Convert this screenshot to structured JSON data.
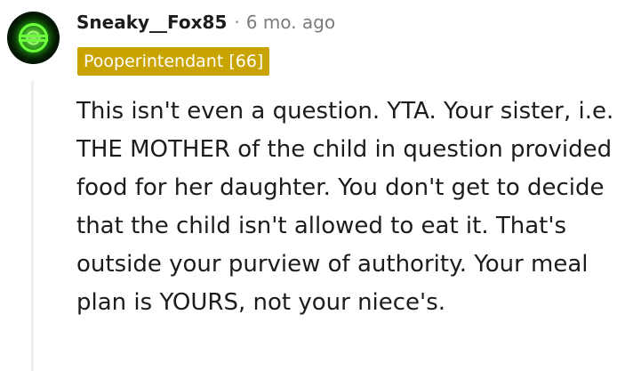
{
  "comment": {
    "username": "Sneaky__Fox85",
    "separator": "·",
    "timestamp": "6 mo. ago",
    "flair": "Pooperintendant [66]",
    "body": "This isn't even a question. YTA. Your sister, i.e. THE MOTHER of the child in question provided food for her daughter. You don't get to decide that the child isn't allowed to eat it. That's outside your purview of authority. Your meal plan is YOURS, not your niece's.",
    "avatar_icon": "green-lantern-emblem-icon"
  },
  "colors": {
    "flair_background": "#c9a400",
    "flair_text": "#ffffff",
    "username": "#1c1c1c",
    "timestamp": "#7c7c7c",
    "thread_line": "#edeff1",
    "avatar_glow": "#39ff14"
  }
}
